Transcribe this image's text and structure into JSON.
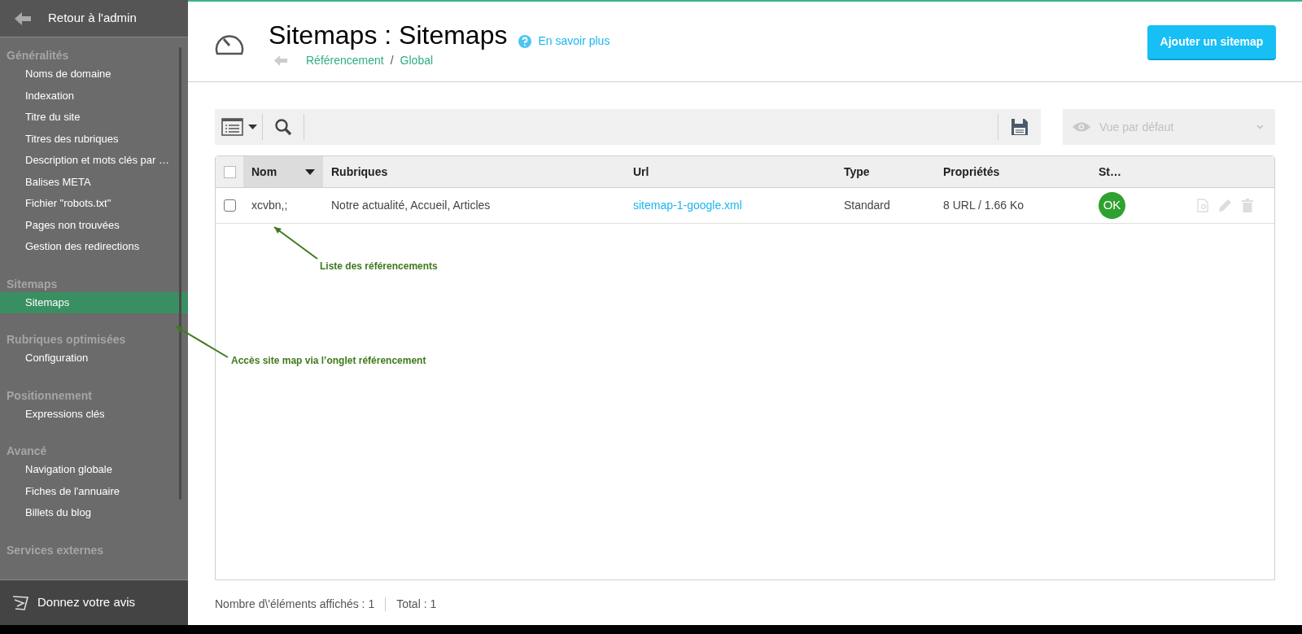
{
  "sidebar": {
    "back_link": "Retour à l'admin",
    "sections": [
      {
        "title": "Généralités",
        "items": [
          {
            "label": "Noms de domaine",
            "selected": false
          },
          {
            "label": "Indexation",
            "selected": false
          },
          {
            "label": "Titre du site",
            "selected": false
          },
          {
            "label": "Titres des rubriques",
            "selected": false
          },
          {
            "label": "Description et mots clés par …",
            "selected": false
          },
          {
            "label": "Balises META",
            "selected": false
          },
          {
            "label": "Fichier \"robots.txt\"",
            "selected": false
          },
          {
            "label": "Pages non trouvées",
            "selected": false
          },
          {
            "label": "Gestion des redirections",
            "selected": false
          }
        ]
      },
      {
        "title": "Sitemaps",
        "items": [
          {
            "label": "Sitemaps",
            "selected": true
          }
        ]
      },
      {
        "title": "Rubriques optimisées",
        "items": [
          {
            "label": "Configuration",
            "selected": false
          }
        ]
      },
      {
        "title": "Positionnement",
        "items": [
          {
            "label": "Expressions clés",
            "selected": false
          }
        ]
      },
      {
        "title": "Avancé",
        "items": [
          {
            "label": "Navigation globale",
            "selected": false
          },
          {
            "label": "Fiches de l'annuaire",
            "selected": false
          },
          {
            "label": "Billets du blog",
            "selected": false
          }
        ]
      },
      {
        "title": "Services externes"
      }
    ],
    "feedback": "Donnez votre avis"
  },
  "header": {
    "title": "Sitemaps : Sitemaps",
    "help_link": "En savoir plus",
    "breadcrumb": [
      "Référencement",
      "Global"
    ],
    "breadcrumb_separator": "/",
    "add_button": "Ajouter un sitemap"
  },
  "toolbar": {
    "view_select": "Vue par défaut"
  },
  "table": {
    "select_all_checked": false,
    "columns": [
      {
        "label": "Nom",
        "sorted": true
      },
      {
        "label": "Rubriques",
        "sorted": false
      },
      {
        "label": "Url",
        "sorted": false
      },
      {
        "label": "Type",
        "sorted": false
      },
      {
        "label": "Propriétés",
        "sorted": false
      },
      {
        "label": "St…",
        "sorted": false
      }
    ],
    "rows": [
      {
        "checked": false,
        "name": "xcvbn,;",
        "rubriques": "Notre actualité, Accueil, Articles",
        "url": "sitemap-1-google.xml",
        "type": "Standard",
        "properties": "8 URL / 1.66 Ko",
        "status": "OK"
      }
    ]
  },
  "footer": {
    "displayed": "Nombre d\\'éléments affichés : 1",
    "total": "Total : 1"
  },
  "annotations": [
    {
      "text": "Liste des référencements"
    },
    {
      "text": "Accès site map via l’onglet référencement"
    }
  ]
}
